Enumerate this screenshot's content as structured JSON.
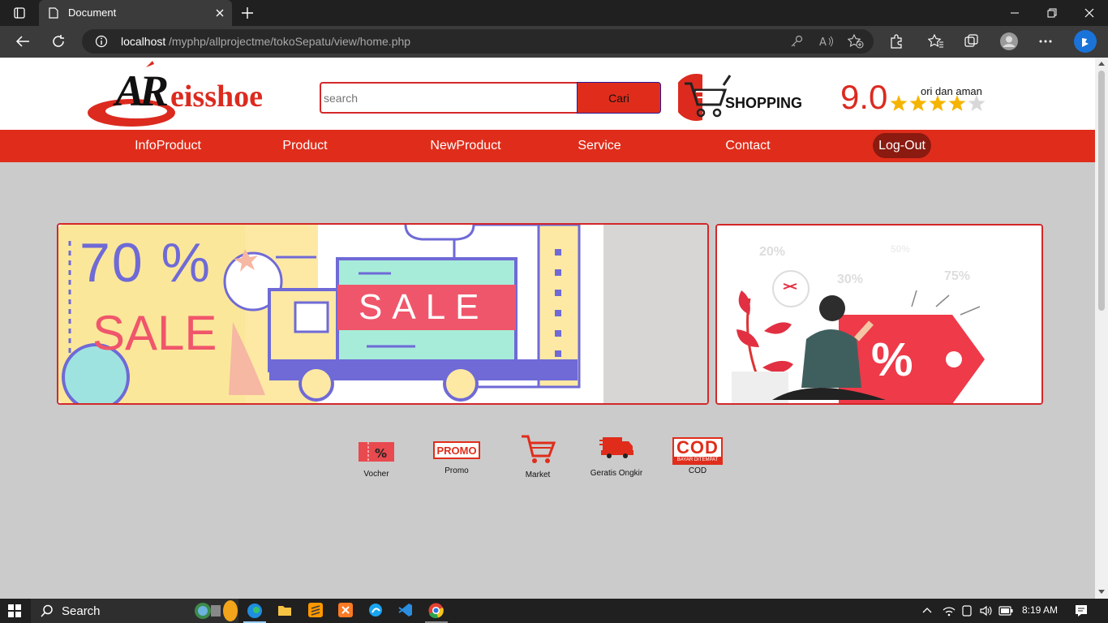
{
  "browser": {
    "tab_title": "Document",
    "url_host": "localhost",
    "url_path": "/myphp/allprojectme/tokoSepatu/view/home.php"
  },
  "header": {
    "logo_text": "eisshoe",
    "logo_letters": "AR",
    "search_placeholder": "search",
    "search_button": "Cari",
    "shopping_label": "SHOPPING",
    "rating_value": "9.0",
    "rating_caption": "ori dan aman",
    "rating_stars": 4
  },
  "nav": {
    "items": [
      {
        "label": "InfoProduct"
      },
      {
        "label": "Product"
      },
      {
        "label": "NewProduct"
      },
      {
        "label": "Service"
      },
      {
        "label": "Contact"
      },
      {
        "label": "Log-Out"
      }
    ]
  },
  "banners": {
    "left": {
      "big_text": "70 %",
      "sale_text": "SALE",
      "truck_text": "SALE"
    },
    "right": {
      "pct_20": "20%",
      "pct_30": "30%",
      "pct_50": "50%",
      "pct_75": "75%",
      "tag_symbol": "%"
    }
  },
  "features": [
    {
      "label": "Vocher",
      "icon": "voucher-icon"
    },
    {
      "label": "Promo",
      "icon": "promo-icon",
      "badge": "PROMO"
    },
    {
      "label": "Market",
      "icon": "cart-icon"
    },
    {
      "label": "Geratis Ongkir",
      "icon": "delivery-truck-icon"
    },
    {
      "label": "COD",
      "icon": "cod-icon",
      "badge": "COD",
      "badge_sub": "BAYAR DITEMPAT"
    }
  ],
  "taskbar": {
    "search_label": "Search",
    "time": "8:19 AM"
  },
  "colors": {
    "brand_red": "#e02d1b",
    "page_bg": "#cbcbcb",
    "logout_bg": "#8b1a10"
  }
}
